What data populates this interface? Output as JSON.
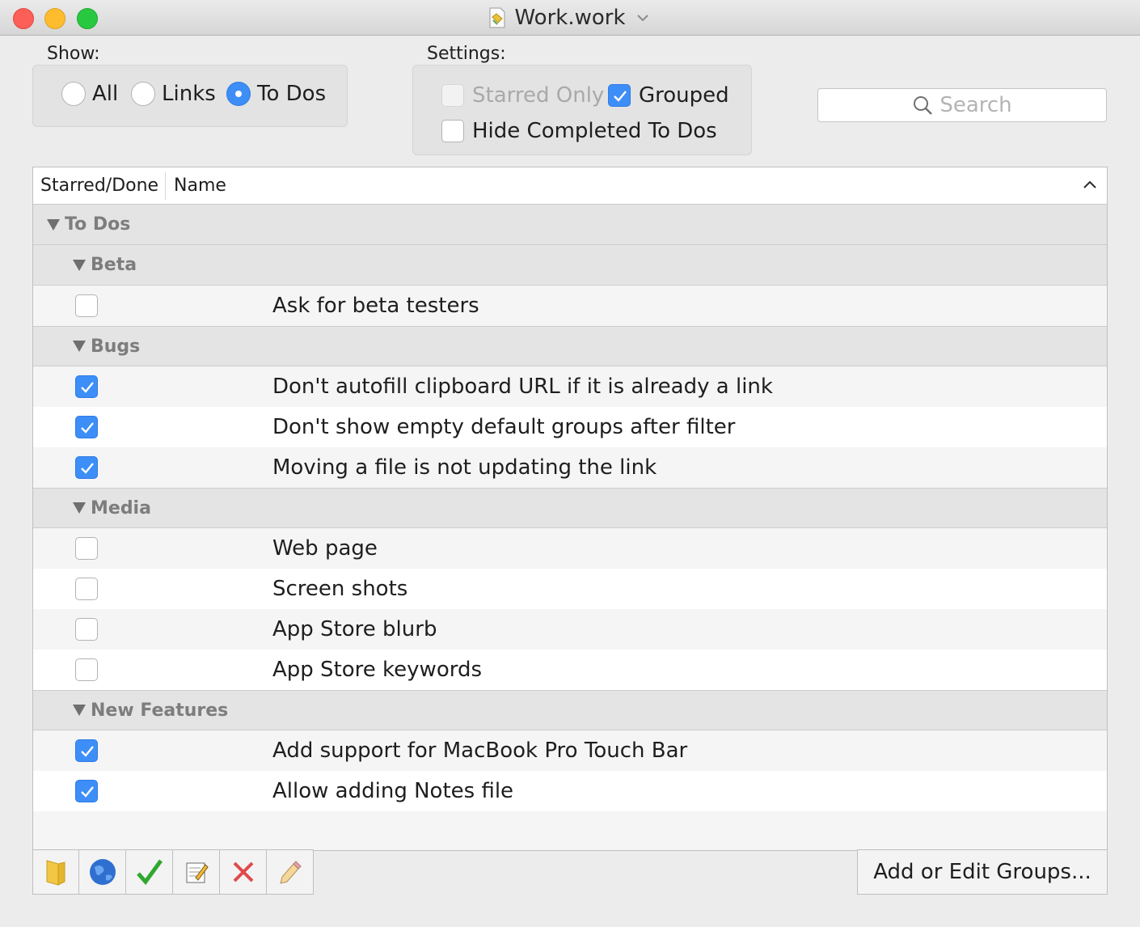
{
  "window": {
    "title": "Work.work",
    "icon": "document-app-icon"
  },
  "show": {
    "label": "Show:",
    "options": [
      {
        "label": "All",
        "selected": false
      },
      {
        "label": "Links",
        "selected": false
      },
      {
        "label": "To Dos",
        "selected": true
      }
    ]
  },
  "settings": {
    "label": "Settings:",
    "starred_only": {
      "label": "Starred Only",
      "checked": false,
      "enabled": false
    },
    "grouped": {
      "label": "Grouped",
      "checked": true,
      "enabled": true
    },
    "hide_completed": {
      "label": "Hide Completed To Dos",
      "checked": false,
      "enabled": true
    }
  },
  "search": {
    "placeholder": "Search"
  },
  "table": {
    "columns": [
      "Starred/Done",
      "Name"
    ],
    "root_group": "To Dos",
    "groups": [
      {
        "name": "Beta",
        "items": [
          {
            "name": "Ask for beta testers",
            "done": false
          }
        ]
      },
      {
        "name": "Bugs",
        "items": [
          {
            "name": "Don't autofill clipboard URL if it is already a link",
            "done": true
          },
          {
            "name": "Don't show empty default groups after filter",
            "done": true
          },
          {
            "name": "Moving a file is not updating the link",
            "done": true
          }
        ]
      },
      {
        "name": "Media",
        "items": [
          {
            "name": "Web page",
            "done": false
          },
          {
            "name": "Screen shots",
            "done": false
          },
          {
            "name": "App Store blurb",
            "done": false
          },
          {
            "name": "App Store keywords",
            "done": false
          }
        ]
      },
      {
        "name": "New Features",
        "items": [
          {
            "name": "Add support for MacBook Pro Touch Bar",
            "done": true
          },
          {
            "name": "Allow adding Notes file",
            "done": true
          }
        ]
      }
    ]
  },
  "toolbar": {
    "buttons": [
      "folder-icon",
      "globe-icon",
      "checkmark-icon",
      "notepad-icon",
      "delete-x-icon",
      "pencil-icon"
    ],
    "groups_button": "Add or Edit Groups..."
  },
  "colors": {
    "accent": "#3d8ef7",
    "group_header_bg": "#e4e4e4",
    "delete": "#e04a4a",
    "check": "#2fa82f"
  }
}
